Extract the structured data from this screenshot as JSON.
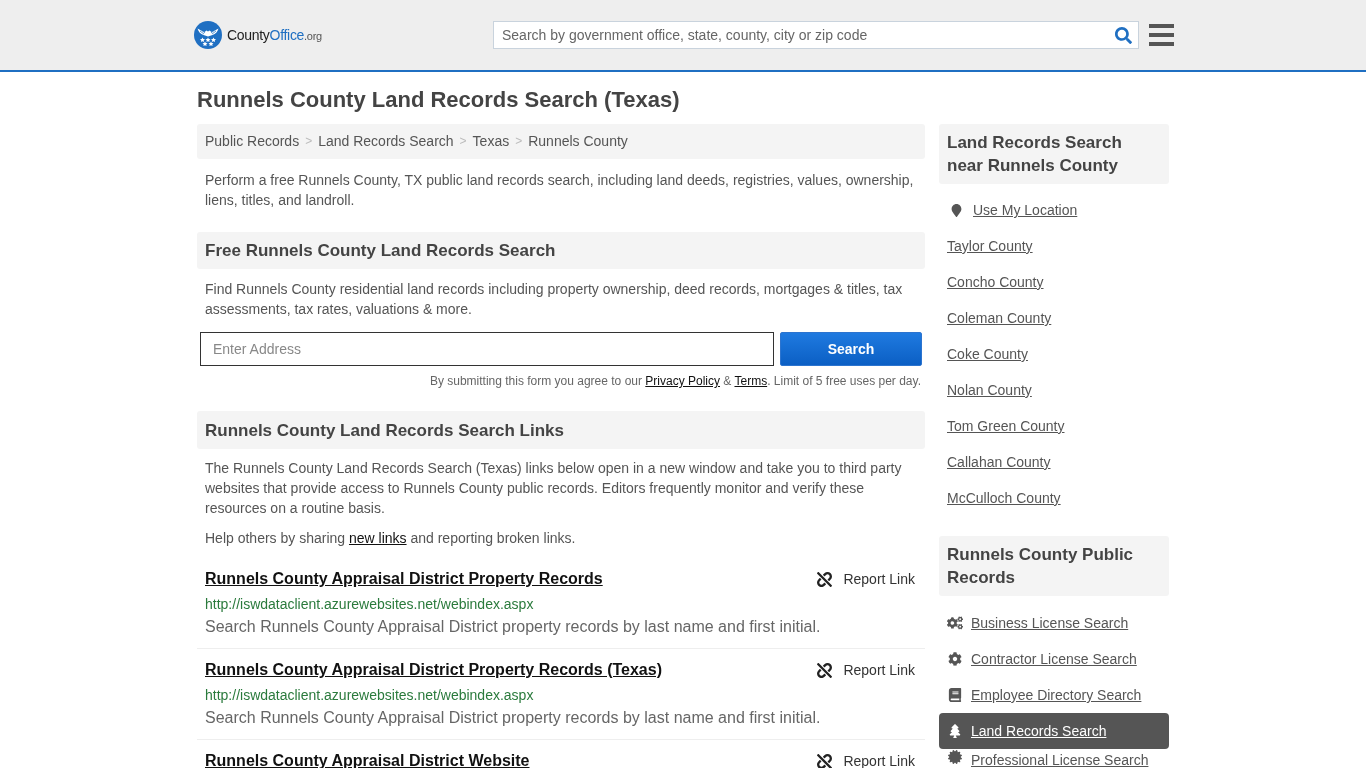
{
  "header": {
    "logo": {
      "parts": [
        {
          "kind": "plain",
          "text": "County"
        },
        {
          "kind": "strong",
          "text": "Office"
        },
        {
          "kind": "suffix",
          "text": ".org"
        }
      ]
    },
    "search": {
      "placeholder": "Search by government office, state, county, city or zip code"
    }
  },
  "page_title": "Runnels County Land Records Search (Texas)",
  "breadcrumb_separator": ">",
  "breadcrumbs": [
    {
      "label": "Public Records"
    },
    {
      "label": "Land Records Search"
    },
    {
      "label": "Texas"
    },
    {
      "label": "Runnels County"
    }
  ],
  "intro": "Perform a free Runnels County, TX public land records search, including land deeds, registries, values, ownership, liens, titles, and landroll.",
  "search_section": {
    "heading": "Free Runnels County Land Records Search",
    "text": "Find Runnels County residential land records including property ownership, deed records, mortgages & titles, tax assessments, tax rates, valuations & more.",
    "address_field": {
      "placeholder": "Enter Address"
    },
    "submit_button": "Search",
    "disclaimer": [
      {
        "kind": "text",
        "text": "By submitting this form you agree to our "
      },
      {
        "kind": "link",
        "text": "Privacy Policy"
      },
      {
        "kind": "text",
        "text": " & "
      },
      {
        "kind": "link",
        "text": "Terms"
      },
      {
        "kind": "text",
        "text": ". Limit of 5 free uses per day."
      }
    ]
  },
  "links_section": {
    "heading": "Runnels County Land Records Search Links",
    "text": "The Runnels County Land Records Search (Texas) links below open in a new window and take you to third party websites that provide access to Runnels County public records. Editors frequently monitor and verify these resources on a routine basis.",
    "help": [
      {
        "kind": "text",
        "text": "Help others by sharing "
      },
      {
        "kind": "link",
        "text": "new links"
      },
      {
        "kind": "text",
        "text": " and reporting broken links."
      }
    ],
    "links": [
      {
        "title": "Runnels County Appraisal District Property Records",
        "url": "http://iswdataclient.azurewebsites.net/webindex.aspx",
        "description": "Search Runnels County Appraisal District property records by last name and first initial.",
        "report": "Report Link"
      },
      {
        "title": "Runnels County Appraisal District Property Records (Texas)",
        "url": "http://iswdataclient.azurewebsites.net/webindex.aspx",
        "description": "Search Runnels County Appraisal District property records by last name and first initial.",
        "report": "Report Link"
      },
      {
        "title": "Runnels County Appraisal District Website",
        "report": "Report Link"
      }
    ]
  },
  "sidebar": {
    "nearby": {
      "heading": "Land Records Search near Runnels County",
      "items": [
        {
          "kind": "location",
          "label": "Use My Location"
        },
        {
          "kind": "county",
          "label": "Taylor County"
        },
        {
          "kind": "county",
          "label": "Concho County"
        },
        {
          "kind": "county",
          "label": "Coleman County"
        },
        {
          "kind": "county",
          "label": "Coke County"
        },
        {
          "kind": "county",
          "label": "Nolan County"
        },
        {
          "kind": "county",
          "label": "Tom Green County"
        },
        {
          "kind": "county",
          "label": "Callahan County"
        },
        {
          "kind": "county",
          "label": "McCulloch County"
        }
      ]
    },
    "public_records": {
      "heading": "Runnels County Public Records",
      "items": [
        {
          "label": "Business License Search",
          "selected": false
        },
        {
          "label": "Contractor License Search",
          "selected": false
        },
        {
          "label": "Employee Directory Search",
          "selected": false
        },
        {
          "label": "Land Records Search",
          "selected": true
        },
        {
          "label": "Professional License Search",
          "selected": false
        }
      ]
    }
  }
}
